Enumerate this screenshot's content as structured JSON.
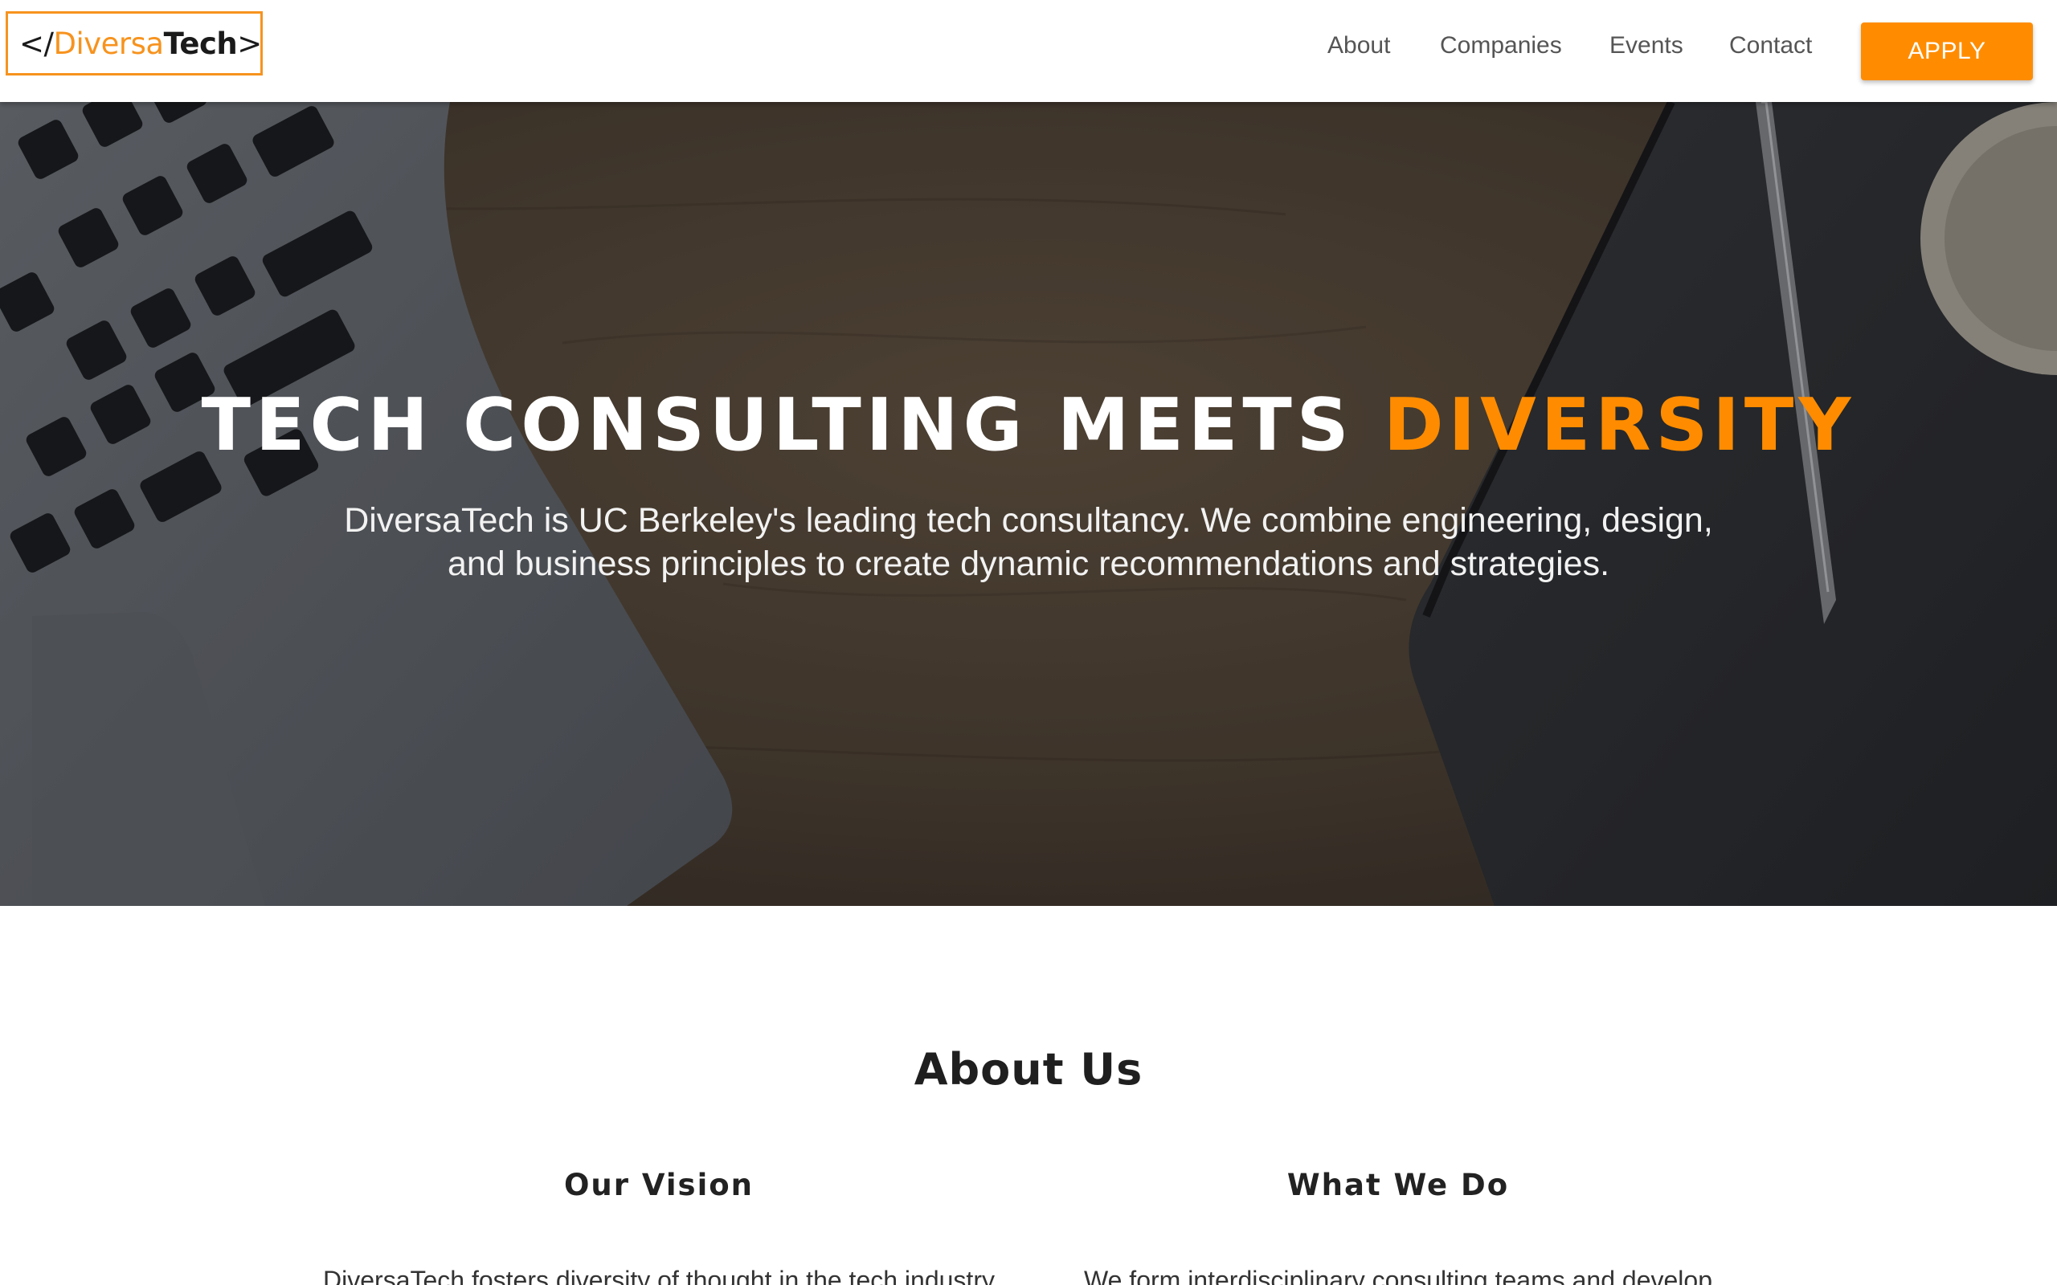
{
  "nav": {
    "logo": {
      "open": "</",
      "light": "Diversa",
      "bold": "Tech",
      "close": ">"
    },
    "links": [
      "About",
      "Companies",
      "Events",
      "Contact"
    ],
    "apply_label": "APPLY"
  },
  "hero": {
    "title_main": "TECH CONSULTING MEETS ",
    "title_accent": "DIVERSITY",
    "subtitle_line1": "DiversaTech is UC Berkeley's leading tech consultancy. We combine engineering, design,",
    "subtitle_line2": "and business principles to create dynamic recommendations and strategies."
  },
  "about": {
    "title": "About Us",
    "vision": {
      "title": "Our Vision",
      "text": "DiversaTech fosters diversity of thought in the tech industry"
    },
    "what_we_do": {
      "title": "What We Do",
      "text": "We form interdisciplinary consulting teams and develop"
    }
  },
  "colors": {
    "accent": "#ff8c00",
    "logo_border": "#f7931e"
  }
}
